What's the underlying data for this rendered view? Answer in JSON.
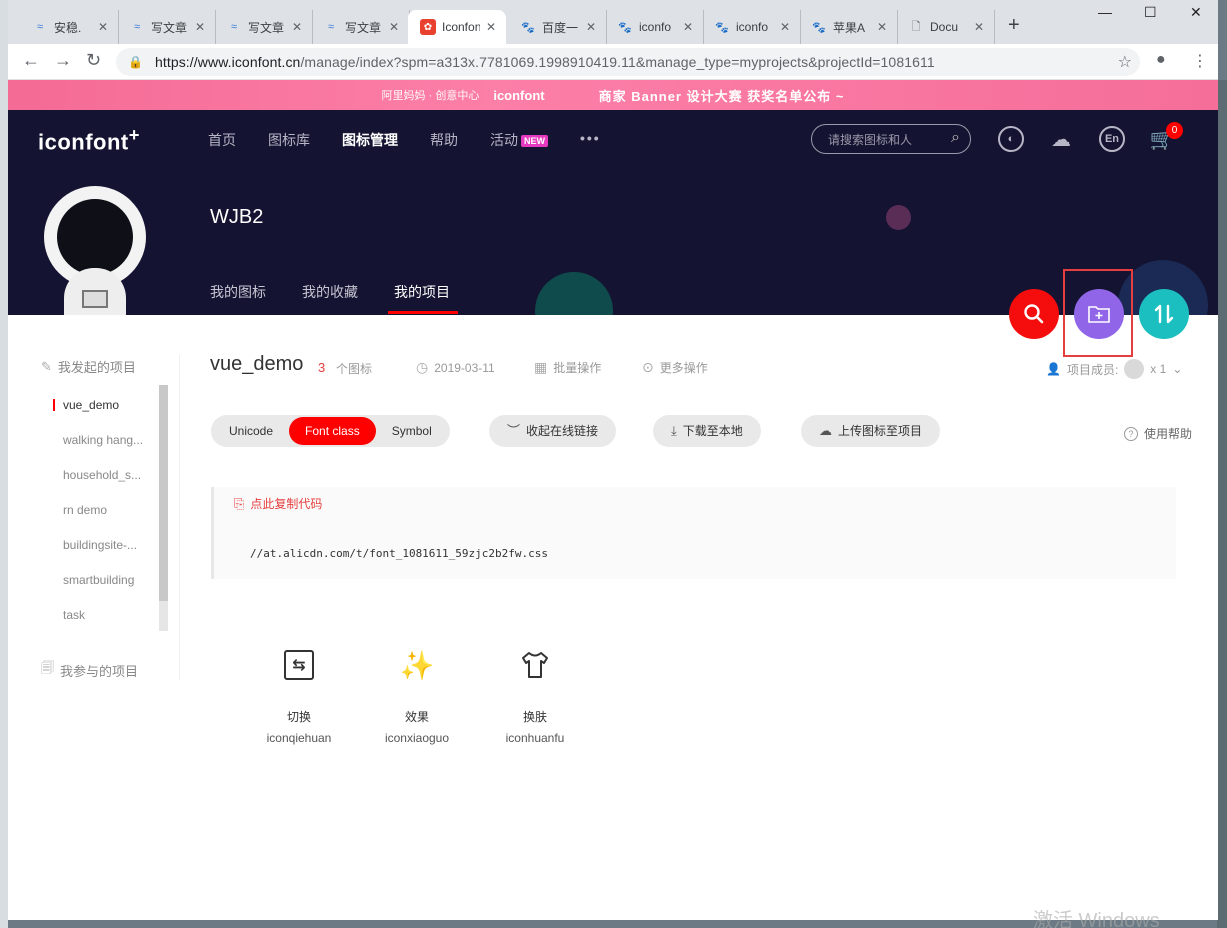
{
  "browser": {
    "tabs": [
      {
        "label": "安稳.",
        "fav": "≈",
        "favclass": "blue"
      },
      {
        "label": "写文章",
        "fav": "≈",
        "favclass": "blue"
      },
      {
        "label": "写文章",
        "fav": "≈",
        "favclass": "blue"
      },
      {
        "label": "写文章",
        "fav": "≈",
        "favclass": "blue"
      },
      {
        "label": "Iconfont",
        "fav": "✿",
        "favclass": "red"
      },
      {
        "label": "百度一",
        "fav": "🐾",
        "favclass": "paw"
      },
      {
        "label": "iconfo",
        "fav": "🐾",
        "favclass": "paw"
      },
      {
        "label": "iconfo",
        "fav": "🐾",
        "favclass": "paw"
      },
      {
        "label": "苹果A",
        "fav": "🐾",
        "favclass": "paw"
      },
      {
        "label": "Docu",
        "fav": "🗋",
        "favclass": "doc"
      }
    ],
    "url_host": "https://www.iconfont.cn",
    "url_path": "/manage/index?spm=a313x.7781069.1998910419.11&manage_type=myprojects&projectId=1081611"
  },
  "banner": {
    "ali": "阿里妈妈 · 创意中心",
    "brand": "iconfont",
    "promo": "商家 Banner 设计大赛   获奖名单公布 ~"
  },
  "header": {
    "logo": "iconfont",
    "nav": [
      "首页",
      "图标库",
      "图标管理",
      "帮助",
      "活动"
    ],
    "new_tag": "NEW",
    "more": "•••",
    "search_placeholder": "请搜索图标和人",
    "lang": "En",
    "cart_count": "0",
    "username": "WJB2",
    "subnav": [
      "我的图标",
      "我的收藏",
      "我的项目"
    ]
  },
  "sidebar": {
    "initiated_title": "我发起的项目",
    "joined_title": "我参与的项目",
    "projects": [
      "vue_demo",
      "walking hang...",
      "household_s...",
      "rn demo",
      "buildingsite-...",
      "smartbuilding",
      "task"
    ]
  },
  "project": {
    "name": "vue_demo",
    "icon_count": "3",
    "icon_count_label": "个图标",
    "date": "2019-03-11",
    "batch_op": "批量操作",
    "more_op": "更多操作",
    "members_label": "项目成员:",
    "members_count": "x 1",
    "formats": [
      "Unicode",
      "Font class",
      "Symbol"
    ],
    "actions": [
      "收起在线链接",
      "下载至本地",
      "上传图标至项目"
    ],
    "help": "使用帮助",
    "copy_code": "点此复制代码",
    "css_url": "//at.alicdn.com/t/font_1081611_59zjc2b2fw.css",
    "icons": [
      {
        "cn": "切换",
        "en": "iconqiehuan"
      },
      {
        "cn": "效果",
        "en": "iconxiaoguo"
      },
      {
        "cn": "换肤",
        "en": "iconhuanfu"
      }
    ]
  },
  "watermark": "激活 Windows"
}
